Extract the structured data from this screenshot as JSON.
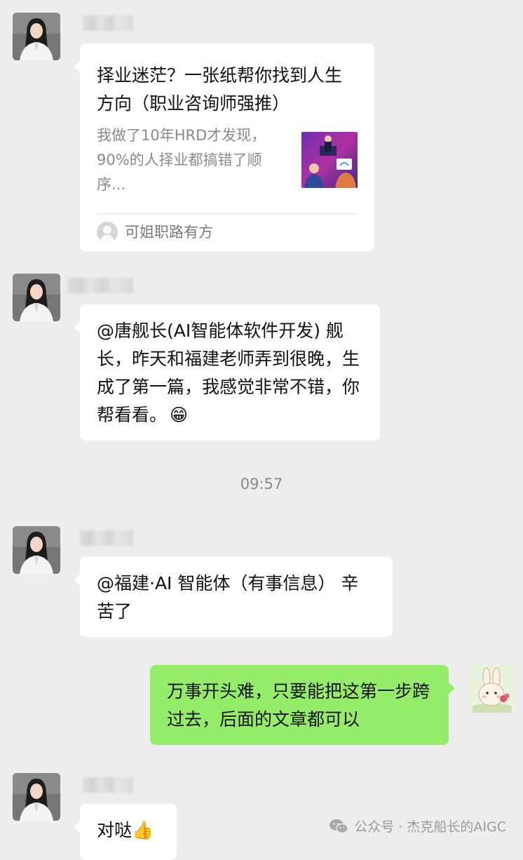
{
  "messages": [
    {
      "card": {
        "title": "择业迷茫？一张纸帮你找到人生方向（职业咨询师强推）",
        "description": "我做了10年HRD才发现，90%的人择业都搞错了顺序...",
        "source": "可姐职路有方"
      }
    },
    {
      "text": "@唐舰长(AI智能体软件开发) 舰长，昨天和福建老师弄到很晚，生成了第一篇，我感觉非常不错，你帮看看。",
      "emoji": "😁"
    },
    {
      "timestamp": "09:57"
    },
    {
      "text": "@福建·AI 智能体（有事信息） 辛苦了"
    },
    {
      "text": "万事开头难，只要能把这第一步跨过去，后面的文章都可以",
      "self": true
    },
    {
      "text": "对哒",
      "emoji": "👍"
    }
  ],
  "watermark": "公众号 · 杰克船长的AIGC",
  "colors": {
    "background": "#ededed",
    "self_bubble": "#95ec69",
    "other_bubble": "#ffffff"
  }
}
